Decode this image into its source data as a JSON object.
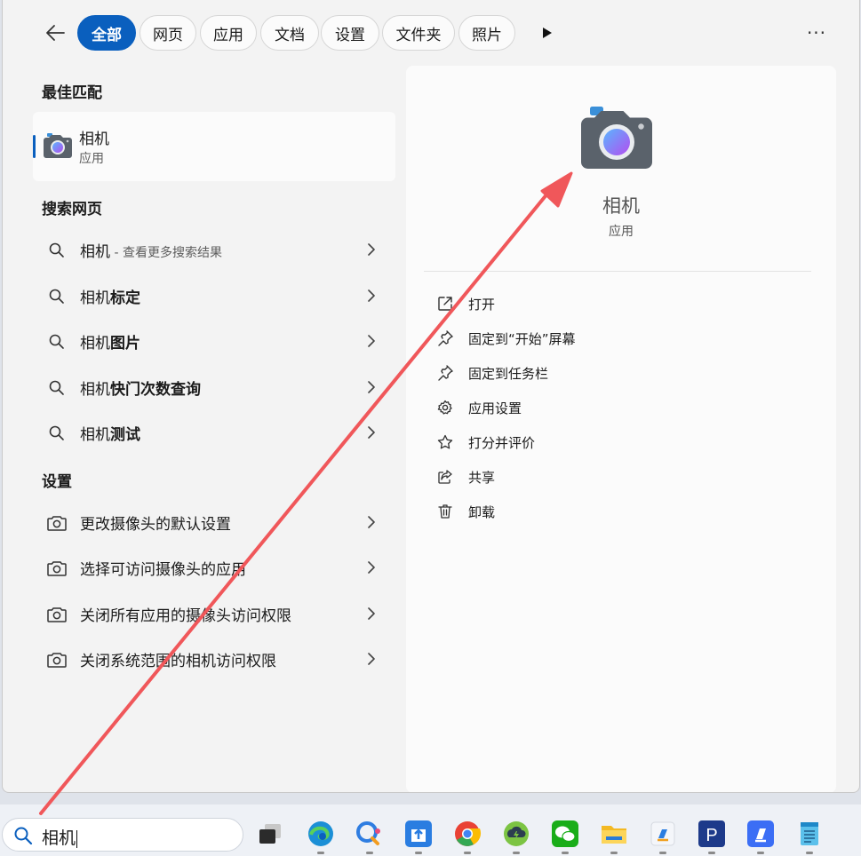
{
  "tabs": [
    {
      "label": "全部",
      "active": true
    },
    {
      "label": "网页",
      "active": false
    },
    {
      "label": "应用",
      "active": false
    },
    {
      "label": "文档",
      "active": false
    },
    {
      "label": "设置",
      "active": false
    },
    {
      "label": "文件夹",
      "active": false
    },
    {
      "label": "照片",
      "active": false
    }
  ],
  "more_menu": "···",
  "best_match": {
    "section_title": "最佳匹配",
    "name": "相机",
    "kind": "应用"
  },
  "web_search": {
    "section_title": "搜索网页",
    "items": [
      {
        "prefix": "相机",
        "bold": "",
        "hint": " - 查看更多搜索结果"
      },
      {
        "prefix": "相机",
        "bold": "标定",
        "hint": ""
      },
      {
        "prefix": "相机",
        "bold": "图片",
        "hint": ""
      },
      {
        "prefix": "相机",
        "bold": "快门次数查询",
        "hint": ""
      },
      {
        "prefix": "相机",
        "bold": "测试",
        "hint": ""
      }
    ]
  },
  "settings": {
    "section_title": "设置",
    "items": [
      {
        "label": "更改摄像头的默认设置"
      },
      {
        "label": "选择可访问摄像头的应用"
      },
      {
        "label": "关闭所有应用的摄像头访问权限"
      },
      {
        "label": "关闭系统范围的相机访问权限"
      }
    ]
  },
  "detail": {
    "name": "相机",
    "kind": "应用",
    "actions": [
      {
        "label": "打开",
        "icon": "open-external-icon"
      },
      {
        "label": "固定到“开始”屏幕",
        "icon": "pin-icon"
      },
      {
        "label": "固定到任务栏",
        "icon": "pin-icon"
      },
      {
        "label": "应用设置",
        "icon": "gear-icon"
      },
      {
        "label": "打分并评价",
        "icon": "star-icon"
      },
      {
        "label": "共享",
        "icon": "share-icon"
      },
      {
        "label": "卸载",
        "icon": "trash-icon"
      }
    ]
  },
  "search": {
    "value": "相机"
  },
  "taskbar": {
    "apps": [
      "task-view",
      "edge",
      "copilot",
      "tencent-app",
      "chrome",
      "baidu-netdisk",
      "wechat",
      "file-explorer",
      "remote-desktop-app",
      "pdf-app",
      "remote-app-2",
      "notepad"
    ]
  },
  "colors": {
    "accent": "#0a5fbe",
    "arrow": "#f0575a",
    "panel": "#f3f3f3"
  }
}
